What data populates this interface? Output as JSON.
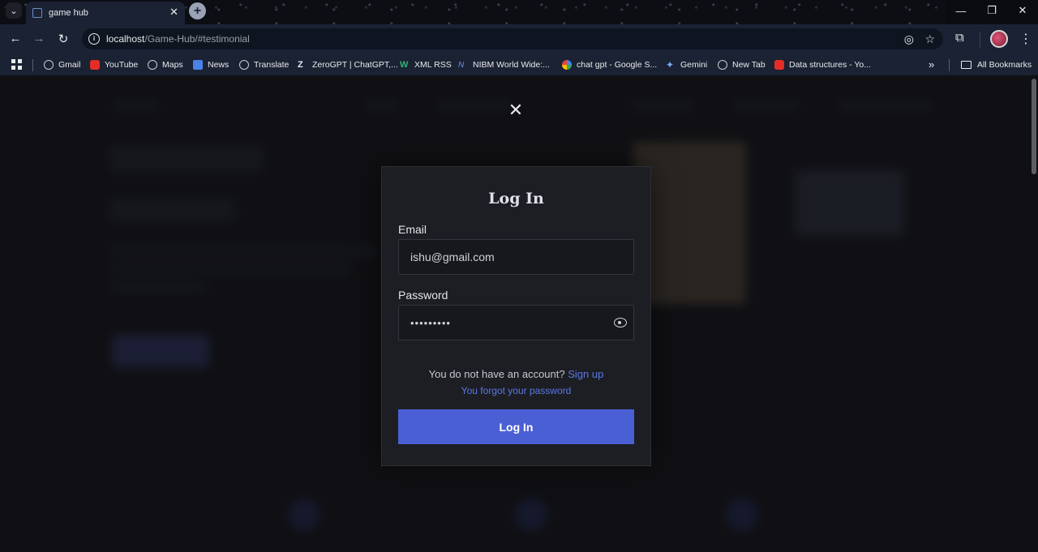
{
  "browser": {
    "tab": {
      "title": "game hub"
    },
    "url": {
      "host": "localhost",
      "path": "/Game-Hub/#testimonial"
    },
    "bookmarks": [
      {
        "label": "Gmail",
        "icon": "globe-icon"
      },
      {
        "label": "YouTube",
        "icon": "youtube-icon"
      },
      {
        "label": "Maps",
        "icon": "globe-icon"
      },
      {
        "label": "News",
        "icon": "news-icon"
      },
      {
        "label": "Translate",
        "icon": "globe-icon"
      },
      {
        "label": "ZeroGPT | ChatGPT,...",
        "icon": "zerogpt-icon"
      },
      {
        "label": "XML RSS",
        "icon": "w-icon"
      },
      {
        "label": "NIBM World Wide:...",
        "icon": "nibm-icon"
      },
      {
        "label": "chat gpt - Google S...",
        "icon": "google-icon"
      },
      {
        "label": "Gemini",
        "icon": "gemini-icon"
      },
      {
        "label": "New Tab",
        "icon": "globe-icon"
      },
      {
        "label": "Data structures - Yo...",
        "icon": "youtube-icon"
      }
    ],
    "all_bookmarks": "All Bookmarks"
  },
  "login_modal": {
    "title": "Log In",
    "email_label": "Email",
    "email_value": "ishu@gmail.com",
    "password_label": "Password",
    "password_value": "•••••••••",
    "no_account_text": "You do not have an account?",
    "signup_link": "Sign up",
    "forgot_link": "You forgot your password",
    "submit_label": "Log In"
  },
  "colors": {
    "accent": "#4b5fd4",
    "link": "#5b78e6",
    "modal_bg": "#1c1e23"
  }
}
